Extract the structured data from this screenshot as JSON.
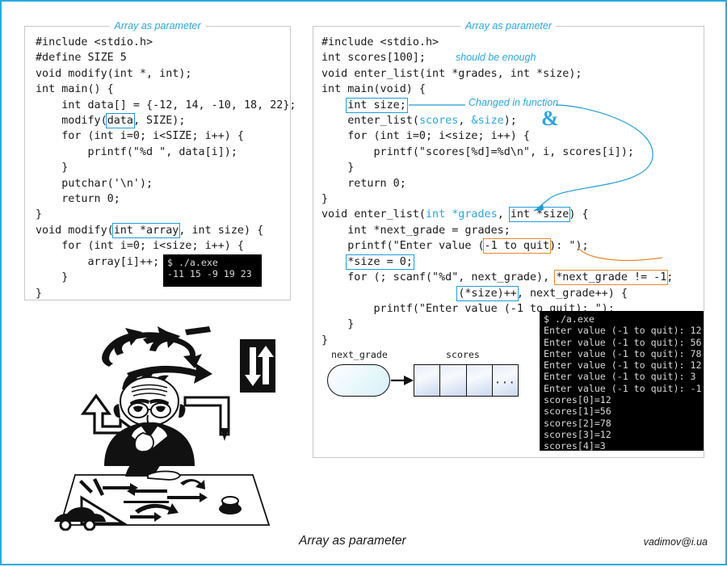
{
  "slide": {
    "footer_title": "Array as parameter",
    "footer_email": "vadimov@i.ua",
    "accent_blue": "#29ABE2",
    "accent_orange": "#E8872B",
    "panel_border": "#c8c8c8"
  },
  "left_panel": {
    "legend": "Array as parameter",
    "code_lines": [
      "#include <stdio.h>",
      "#define SIZE 5",
      "void modify(int *, int);",
      "int main() {",
      "    int data[] = {-12, 14, -10, 18, 22};",
      "    modify(data, SIZE);",
      "    for (int i=0; i<SIZE; i++) {",
      "        printf(\"%d \", data[i]);",
      "    }",
      "    putchar('\\n');",
      "    return 0;",
      "}",
      "void modify(int *array, int size) {",
      "    for (int i=0; i<size; i++) {",
      "        array[i]++;",
      "    }",
      "}"
    ],
    "highlights": [
      "data",
      "int *array"
    ],
    "terminal": {
      "lines": [
        "$ ./a.exe",
        "-11 15 -9 19 23"
      ]
    }
  },
  "right_panel": {
    "legend": "Array as parameter",
    "code_lines": [
      "#include <stdio.h>",
      "int scores[100];",
      "void enter_list(int *grades, int *size);",
      "int main(void) {",
      "    int size;",
      "    enter_list(scores, &size);",
      "    for (int i=0; i<size; i++) {",
      "        printf(\"scores[%d]=%d\\n\", i, scores[i]);",
      "    }",
      "    return 0;",
      "}",
      "void enter_list(int *grades, int *size) {",
      "    int *next_grade = grades;",
      "    printf(\"Enter value (-1 to quit): \");",
      "    *size = 0;",
      "    for (; scanf(\"%d\", next_grade), *next_grade != -1;",
      "                     (*size)++, next_grade++) {",
      "        printf(\"Enter value (-1 to quit): \");",
      "    }",
      "}"
    ],
    "annotations": {
      "should_be_enough": "should be enough",
      "changed_in_function": "Changed in function",
      "ampersand": "&"
    },
    "highlights_blue": [
      "int size;",
      "int *size",
      "*size = 0;",
      "(*size)++"
    ],
    "highlights_orange": [
      "-1 to quit",
      "*next_grade != -1"
    ],
    "blue_tokens": [
      "scores",
      "&size",
      "int *grades"
    ],
    "terminal": {
      "lines": [
        "$ ./a.exe",
        "Enter value (-1 to quit): 12",
        "Enter value (-1 to quit): 56",
        "Enter value (-1 to quit): 78",
        "Enter value (-1 to quit): 12",
        "Enter value (-1 to quit): 3",
        "Enter value (-1 to quit): -1",
        "scores[0]=12",
        "scores[1]=56",
        "scores[2]=78",
        "scores[3]=12",
        "scores[4]=3"
      ]
    },
    "diagram": {
      "pointer_label": "next_grade",
      "array_label": "scores",
      "cell_count": 4,
      "ellipsis": "..."
    }
  }
}
